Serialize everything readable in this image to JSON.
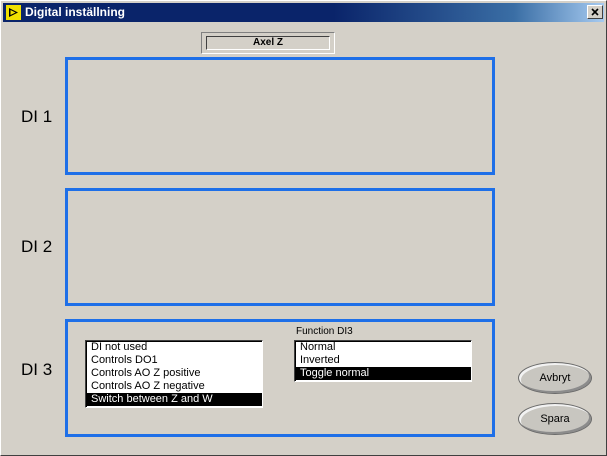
{
  "window": {
    "title": "Digital inställning",
    "close_label": "×"
  },
  "axis_indicator": {
    "label": "Axel Z"
  },
  "sections": [
    {
      "label": "DI 1"
    },
    {
      "label": "DI 2"
    },
    {
      "label": "DI 3"
    }
  ],
  "di3": {
    "mode_list": {
      "items": [
        "DI not used",
        "Controls DO1",
        "Controls AO Z positive",
        "Controls AO Z negative",
        "Switch between Z and W"
      ],
      "selected_index": 4
    },
    "function": {
      "label": "Function DI3",
      "items": [
        "Normal",
        "Inverted",
        "Toggle normal"
      ],
      "selected_index": 2
    }
  },
  "buttons": {
    "cancel_label": "Avbryt",
    "save_label": "Spara"
  },
  "colors": {
    "frame_border": "#1e6fe8",
    "title_bar": "#0a246a"
  }
}
